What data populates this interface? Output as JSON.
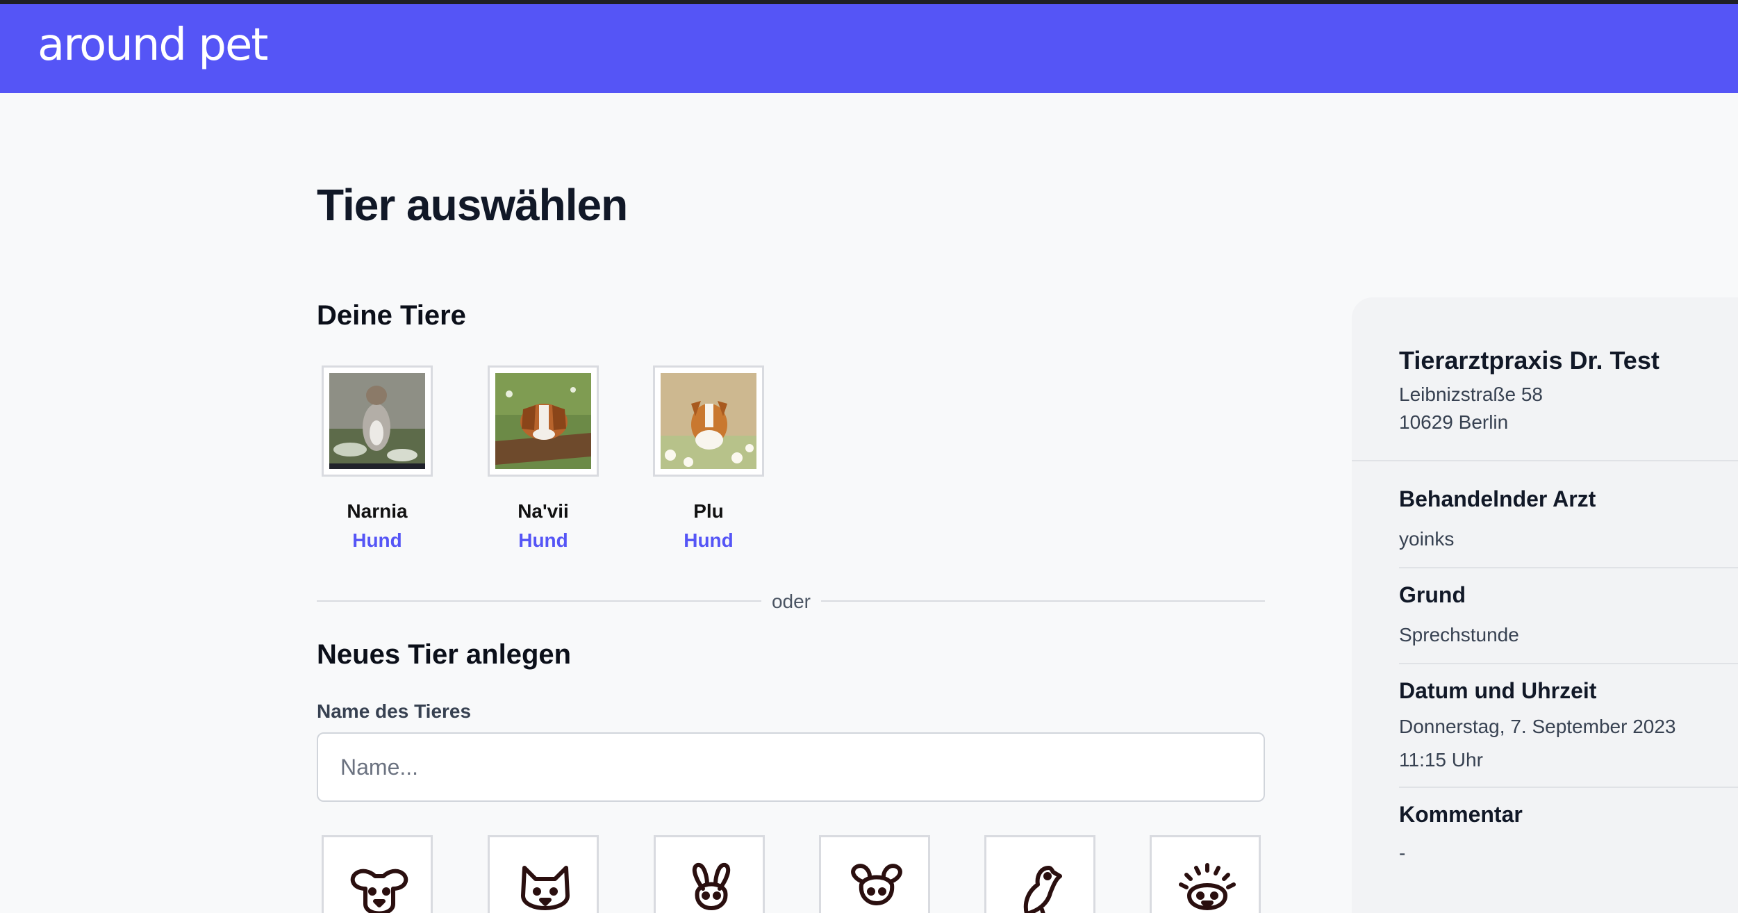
{
  "header": {
    "logo": "around pet",
    "brand_color": "#5555f6"
  },
  "page": {
    "title": "Tier auswählen"
  },
  "my_pets": {
    "title": "Deine Tiere",
    "items": [
      {
        "name": "Narnia",
        "type": "Hund"
      },
      {
        "name": "Na'vii",
        "type": "Hund"
      },
      {
        "name": "Plu",
        "type": "Hund"
      }
    ]
  },
  "divider": {
    "label": "oder"
  },
  "new_pet": {
    "title": "Neues Tier anlegen",
    "name_label": "Name des Tieres",
    "name_placeholder": "Name...",
    "name_value": "",
    "species_icons": [
      "dog-icon",
      "cat-icon",
      "rabbit-icon",
      "rodent-icon",
      "bird-icon",
      "hedgehog-icon"
    ]
  },
  "sidebar": {
    "clinic": "Tierarztpraxis Dr. Test",
    "street": "Leibnizstraße 58",
    "city": "10629 Berlin",
    "vet_label": "Behandelnder Arzt",
    "vet": "yoinks",
    "reason_label": "Grund",
    "reason": "Sprechstunde",
    "datetime_label": "Datum und Uhrzeit",
    "date": "Donnerstag, 7. September 2023",
    "time": "11:15 Uhr",
    "comment_label": "Kommentar",
    "comment": "-"
  }
}
